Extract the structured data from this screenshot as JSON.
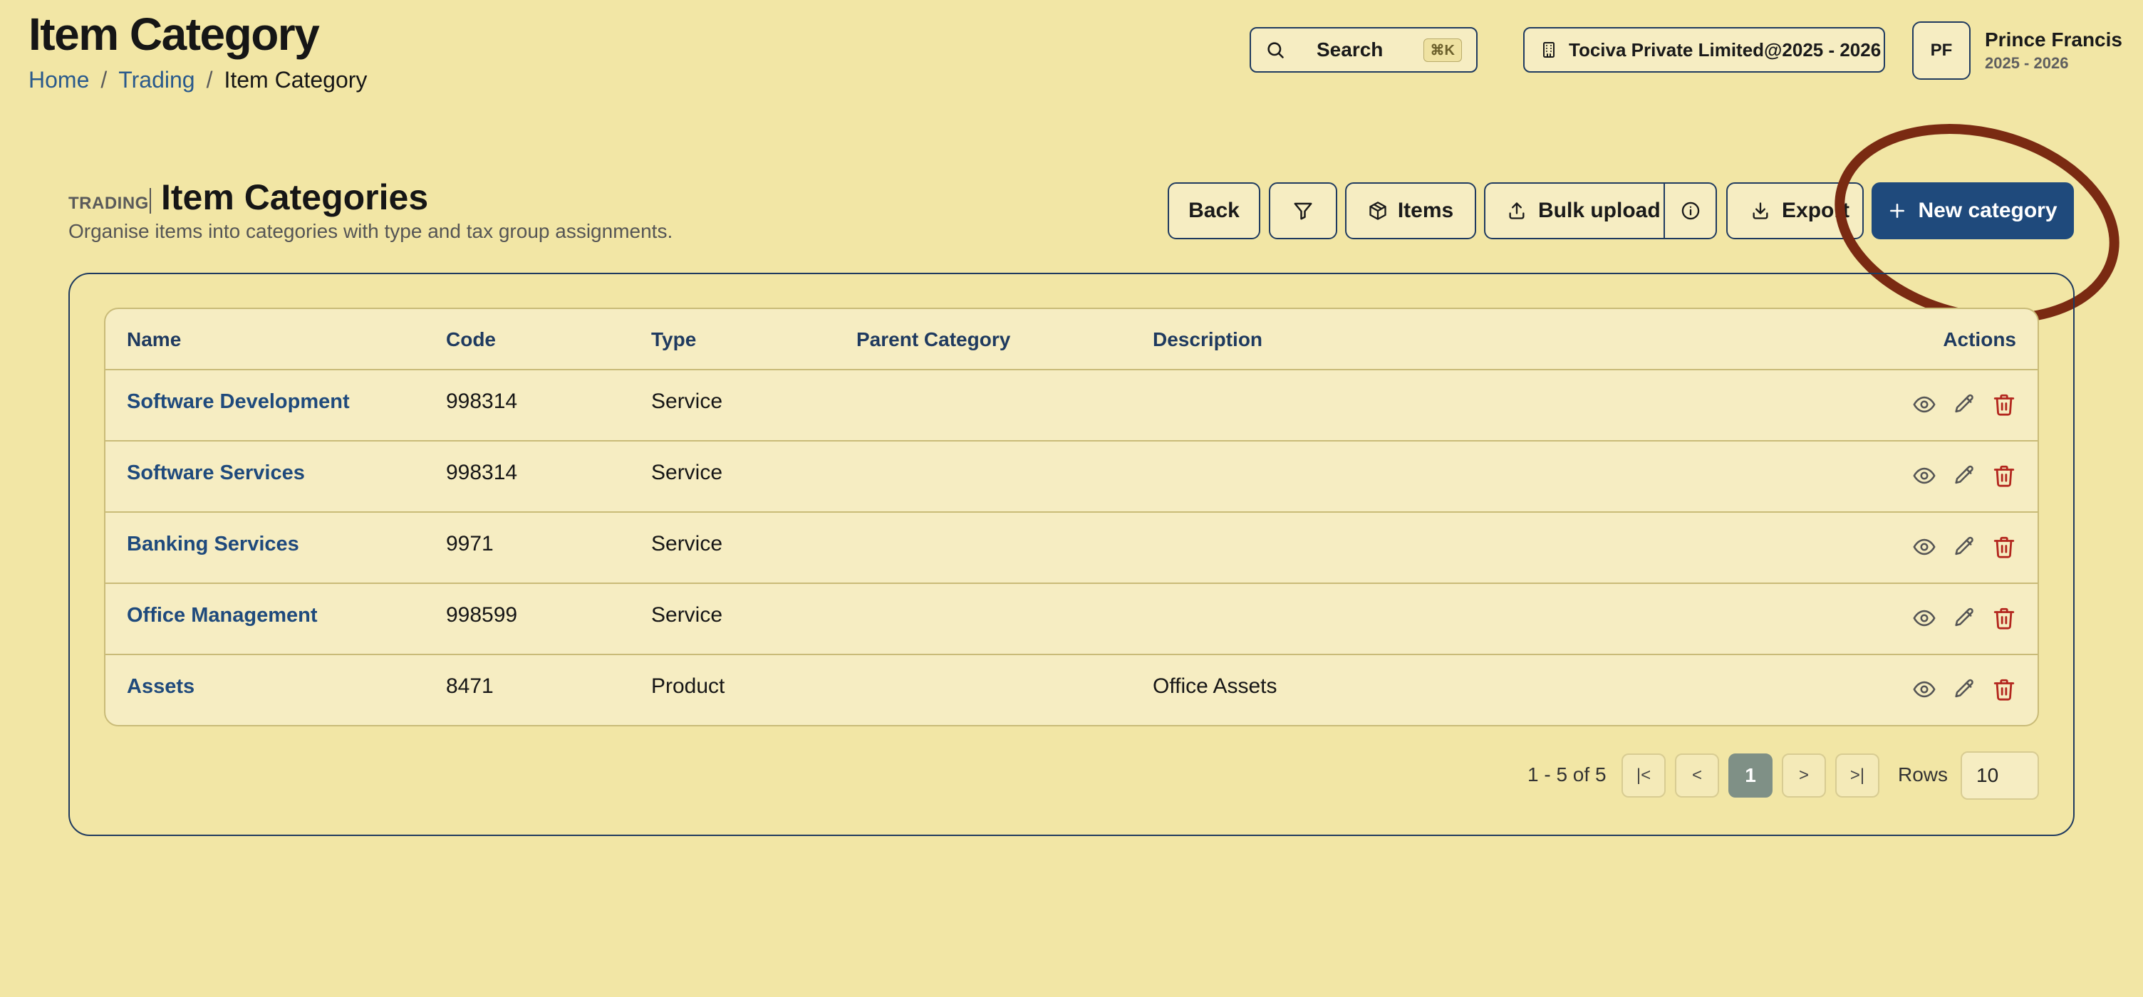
{
  "header": {
    "title": "Item Category",
    "breadcrumb": [
      "Home",
      "Trading",
      "Item Category"
    ]
  },
  "topbar": {
    "search_label": "Search",
    "search_shortcut": "⌘K",
    "org_label": "Tociva Private Limited@2025 - 2026",
    "avatar_initials": "PF",
    "user_name": "Prince Francis",
    "user_period": "2025 - 2026"
  },
  "section": {
    "eyebrow": "TRADING",
    "title": "Item Categories",
    "subtitle": "Organise items into categories with type and tax group assignments."
  },
  "toolbar": {
    "back_label": "Back",
    "items_label": "Items",
    "bulk_upload_label": "Bulk upload",
    "export_label": "Export",
    "new_category_label": "New category"
  },
  "table": {
    "columns": [
      "Name",
      "Code",
      "Type",
      "Parent Category",
      "Description",
      "Actions"
    ],
    "rows": [
      {
        "name": "Software Development",
        "code": "998314",
        "type": "Service",
        "parent": "",
        "description": ""
      },
      {
        "name": "Software Services",
        "code": "998314",
        "type": "Service",
        "parent": "",
        "description": ""
      },
      {
        "name": "Banking Services",
        "code": "9971",
        "type": "Service",
        "parent": "",
        "description": ""
      },
      {
        "name": "Office Management",
        "code": "998599",
        "type": "Service",
        "parent": "",
        "description": ""
      },
      {
        "name": "Assets",
        "code": "8471",
        "type": "Product",
        "parent": "",
        "description": "Office Assets"
      }
    ]
  },
  "pagination": {
    "range_text": "1 - 5 of 5",
    "first_label": "|<",
    "prev_label": "<",
    "current_page": "1",
    "next_label": ">",
    "last_label": ">|",
    "rows_label": "Rows",
    "rows_value": "10"
  },
  "colors": {
    "background": "#f2e6a5",
    "primary": "#1f4a7c",
    "border": "#1f3a5f",
    "delete": "#b3261e",
    "highlight_annotation": "#7a2a12"
  },
  "icons": [
    "search-icon",
    "building-icon",
    "filter-icon",
    "package-icon",
    "upload-icon",
    "info-icon",
    "download-icon",
    "plus-icon",
    "eye-icon",
    "pencil-icon",
    "trash-icon"
  ]
}
